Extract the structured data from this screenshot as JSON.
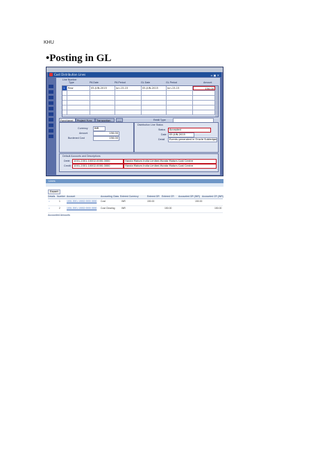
{
  "page": {
    "header": "KHU",
    "title": "•Posting in GL"
  },
  "form": {
    "window_title": "Cost Distribution Lines",
    "columns": [
      "Line Number",
      "Type",
      "PA Date",
      "PA Period",
      "GL Date",
      "GL Period",
      "Amount"
    ],
    "rows": [
      {
        "line": "1",
        "type": "Raw",
        "pa_date": "05-JUN-2015",
        "pa_period": "Jun-15-15",
        "gl_date": "05-JUN-2015",
        "gl_period": "Jun-15-15",
        "amount": "150.00"
      }
    ],
    "tabs": [
      "Functional",
      "Project Func",
      "Transaction"
    ],
    "tab_more": "...",
    "functional": {
      "currency_label": "Currency",
      "currency_value": "INR",
      "amount_label": "Amount",
      "amount_value": "150.00",
      "burdened_label": "Burdened Cost",
      "burdened_value": "150.00"
    },
    "rebill_label": "Rebill Type",
    "distribution": {
      "group_label": "Distribution Line Status",
      "status_label": "Status",
      "status_value": "Accepted",
      "date_label": "Date",
      "date_value": "05-JUN-2015",
      "detail_label": "Detail",
      "detail_value": "Events generated in Oracle Subledger Acc"
    },
    "default_accounts": {
      "group_label": "Default Accounts and Descriptions",
      "debit_label": "Debit",
      "debit_account": "1001.2001.10002.0000.0000",
      "debit_desc": "Honda Motors India Limited.Honda Motors Cost Centre",
      "credit_label": "Credit",
      "credit_account": "1001.2001.10002.0000.0000",
      "credit_desc": "Honda Motors India Limited.Honda Motors Cost Centre"
    }
  },
  "sla": {
    "section_label": "Lines",
    "export_label": "Export",
    "columns": [
      "Details",
      "Number",
      "Account",
      "Accounting Class",
      "Entered Currency",
      "Entered DR",
      "Entered CR",
      "Accounted DR (INR)",
      "Accounted CR (INR)"
    ],
    "rows": [
      {
        "number": "1",
        "account": "1001.2001.10002.0000.0000",
        "class": "Cost",
        "currency": "INR",
        "entered_dr": "150.00",
        "entered_cr": "",
        "acc_dr": "150.00",
        "acc_cr": ""
      },
      {
        "number": "2",
        "account": "1001.2001.10002.0000.0000",
        "class": "Cost Clearing",
        "currency": "INR",
        "entered_dr": "",
        "entered_cr": "150.00",
        "acc_dr": "",
        "acc_cr": "150.00"
      }
    ],
    "footer": "Accounted Amounts"
  }
}
